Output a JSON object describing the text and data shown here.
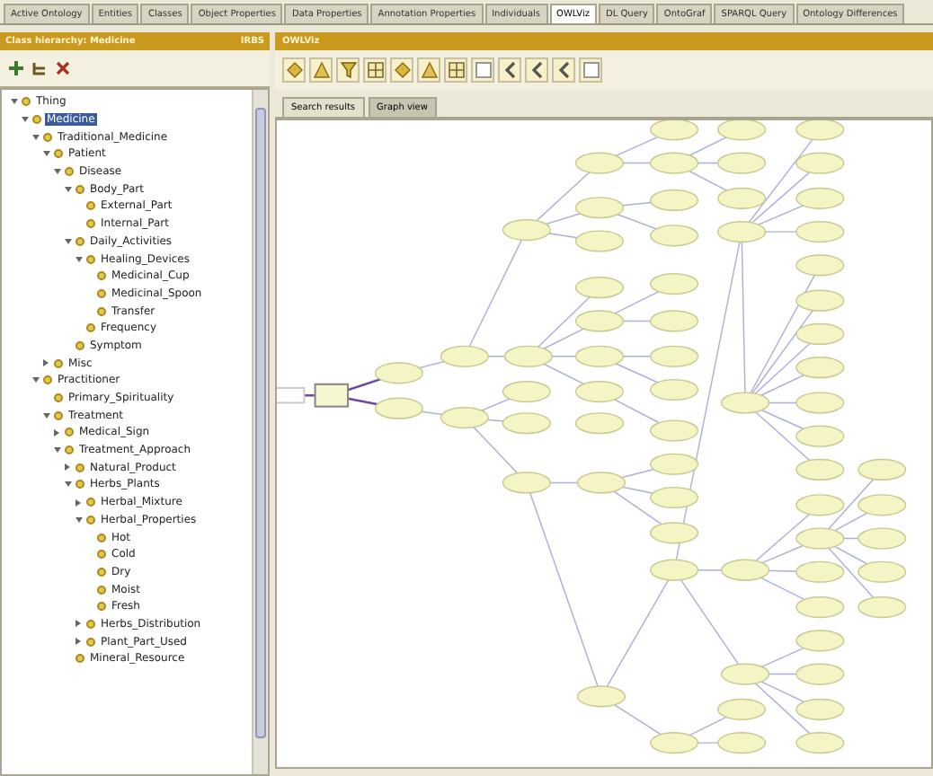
{
  "tabs": [
    {
      "label": "Active Ontology",
      "selected": false
    },
    {
      "label": "Entities",
      "selected": false
    },
    {
      "label": "Classes",
      "selected": false
    },
    {
      "label": "Object Properties",
      "selected": false
    },
    {
      "label": "Data Properties",
      "selected": false
    },
    {
      "label": "Annotation Properties",
      "selected": false
    },
    {
      "label": "Individuals",
      "selected": false
    },
    {
      "label": "OWLViz",
      "selected": true
    },
    {
      "label": "DL Query",
      "selected": false
    },
    {
      "label": "OntoGraf",
      "selected": false
    },
    {
      "label": "SPARQL Query",
      "selected": false
    },
    {
      "label": "Ontology Differences",
      "selected": false
    }
  ],
  "hierarchy": {
    "title": "Class hierarchy: Medicine",
    "badge": "IRBS",
    "tree": [
      {
        "label": "Thing",
        "selected": false,
        "expanded": true,
        "children": [
          {
            "label": "Medicine",
            "selected": true,
            "expanded": true,
            "children": [
              {
                "label": "Traditional_Medicine",
                "selected": false,
                "expanded": true,
                "children": [
                  {
                    "label": "Patient",
                    "selected": false,
                    "expanded": true,
                    "children": [
                      {
                        "label": "Disease",
                        "selected": false,
                        "expanded": true,
                        "children": [
                          {
                            "label": "Body_Part",
                            "selected": false,
                            "expanded": true,
                            "children": [
                              {
                                "label": "External_Part",
                                "selected": false
                              },
                              {
                                "label": "Internal_Part",
                                "selected": false
                              }
                            ]
                          },
                          {
                            "label": "Daily_Activities",
                            "selected": false,
                            "expanded": true,
                            "children": [
                              {
                                "label": "Healing_Devices",
                                "selected": false,
                                "expanded": true,
                                "children": [
                                  {
                                    "label": "Medicinal_Cup",
                                    "selected": false
                                  },
                                  {
                                    "label": "Medicinal_Spoon",
                                    "selected": false
                                  },
                                  {
                                    "label": "Transfer",
                                    "selected": false
                                  }
                                ]
                              },
                              {
                                "label": "Frequency",
                                "selected": false
                              }
                            ]
                          },
                          {
                            "label": "Symptom",
                            "selected": false
                          }
                        ]
                      }
                    ]
                  },
                  {
                    "label": "Misc",
                    "selected": false,
                    "expanded": false
                  }
                ]
              },
              {
                "label": "Practitioner",
                "selected": false,
                "expanded": true,
                "children": [
                  {
                    "label": "Primary_Spirituality",
                    "selected": false
                  },
                  {
                    "label": "Treatment",
                    "selected": false,
                    "expanded": true,
                    "children": [
                      {
                        "label": "Medical_Sign",
                        "selected": false,
                        "expanded": false
                      },
                      {
                        "label": "Treatment_Approach",
                        "selected": false,
                        "expanded": true,
                        "children": [
                          {
                            "label": "Natural_Product",
                            "selected": false,
                            "expanded": false
                          },
                          {
                            "label": "Herbs_Plants",
                            "selected": false,
                            "expanded": true,
                            "children": [
                              {
                                "label": "Herbal_Mixture",
                                "selected": false,
                                "expanded": false
                              },
                              {
                                "label": "Herbal_Properties",
                                "selected": false,
                                "expanded": true,
                                "children": [
                                  {
                                    "label": "Hot",
                                    "selected": false
                                  },
                                  {
                                    "label": "Cold",
                                    "selected": false
                                  },
                                  {
                                    "label": "Dry",
                                    "selected": false
                                  },
                                  {
                                    "label": "Moist",
                                    "selected": false
                                  },
                                  {
                                    "label": "Fresh",
                                    "selected": false
                                  }
                                ]
                              },
                              {
                                "label": "Herbs_Distribution",
                                "selected": false,
                                "expanded": false
                              },
                              {
                                "label": "Plant_Part_Used",
                                "selected": false,
                                "expanded": false
                              }
                            ]
                          },
                          {
                            "label": "Mineral_Resource",
                            "selected": false
                          }
                        ]
                      }
                    ]
                  }
                ]
              }
            ]
          }
        ]
      }
    ]
  },
  "graph": {
    "title": "OWLViz",
    "subtabs": [
      {
        "label": "Search results",
        "selected": false
      },
      {
        "label": "Graph view",
        "selected": true
      }
    ]
  }
}
